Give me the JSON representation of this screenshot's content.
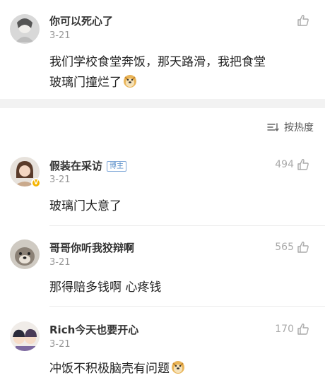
{
  "post": {
    "author": "你可以死心了",
    "date": "3-21",
    "text_line1": "我们学校食堂奔饭，那天路滑，我把食堂",
    "text_line2": "玻璃门撞烂了",
    "emoji": "doge-emoji"
  },
  "sort": {
    "label": "按热度",
    "icon": "sort-icon"
  },
  "comments": [
    {
      "author": "假装在采访",
      "badge": "博主",
      "verified": "V",
      "date": "3-21",
      "likes": "494",
      "text": "玻璃门大意了"
    },
    {
      "author": "哥哥你听我狡辩啊",
      "date": "3-21",
      "likes": "565",
      "text": "那得赔多钱啊  心疼钱"
    },
    {
      "author": "Rich今天也要开心",
      "date": "3-21",
      "likes": "170",
      "text": "冲饭不积极脑壳有问题"
    }
  ],
  "colors": {
    "separator": "#f2f2f2",
    "meta_text": "#999999",
    "badge_blue": "#5a8fc9",
    "verified_gold": "#f5b400"
  }
}
